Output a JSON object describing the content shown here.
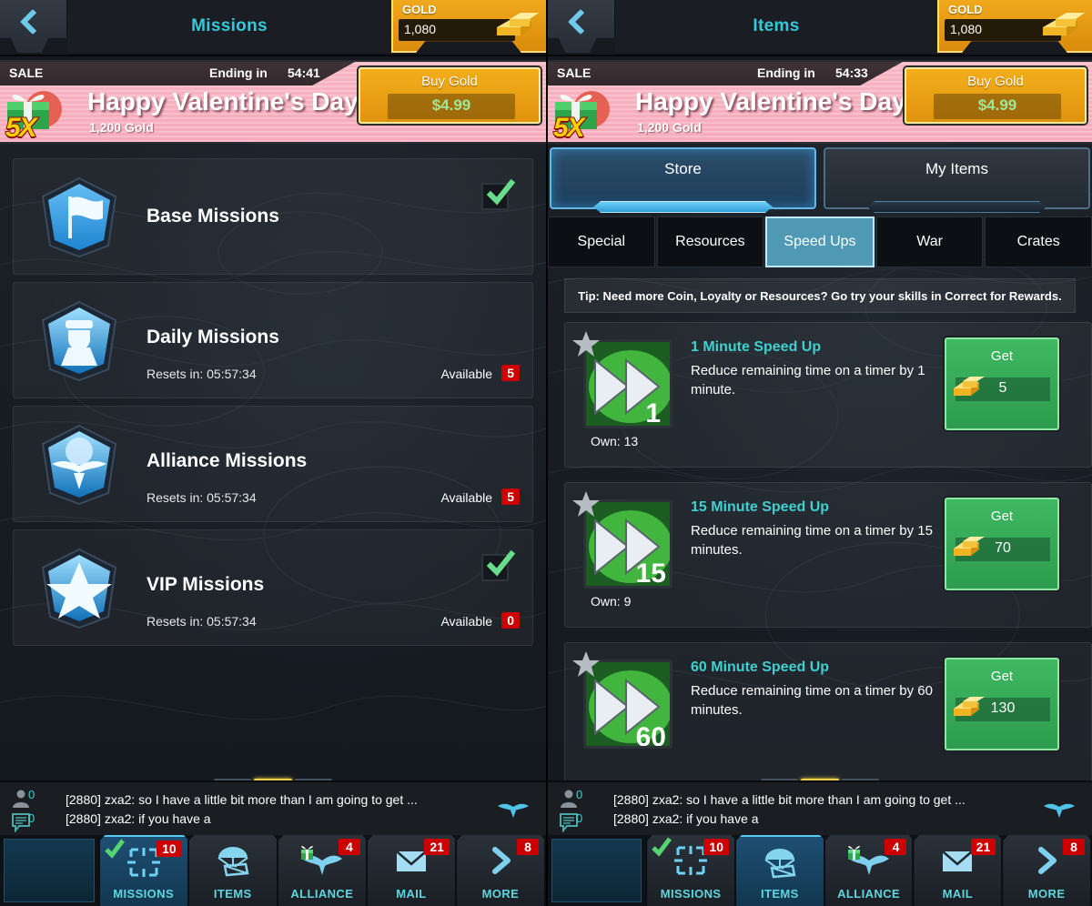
{
  "left": {
    "topbar": {
      "back_icon": "chevron-left-icon",
      "title": "Missions"
    },
    "gold": {
      "label": "GOLD",
      "value": "1,080",
      "icon": "gold-bars-icon"
    },
    "sale": {
      "tag": "SALE",
      "ending_label": "Ending in",
      "ending_time": "54:41",
      "multiplier": "5X",
      "title": "Happy Valentine's Day!",
      "subtitle": "1,200 Gold",
      "buy_label": "Buy Gold",
      "price": "$4.99"
    },
    "missions": [
      {
        "icon": "flag-badge-icon",
        "title": "Base Missions",
        "reset": "",
        "available_label": "",
        "available": "",
        "complete": true
      },
      {
        "icon": "soldier-badge-icon",
        "title": "Daily Missions",
        "reset": "Resets in:  05:57:34",
        "available_label": "Available",
        "available": "5",
        "complete": false
      },
      {
        "icon": "alliance-eagle-badge-icon",
        "title": "Alliance Missions",
        "reset": "Resets in:  05:57:34",
        "available_label": "Available",
        "available": "5",
        "complete": false
      },
      {
        "icon": "star-badge-icon",
        "title": "VIP Missions",
        "reset": "Resets in:  05:57:34",
        "available_label": "Available",
        "available": "0",
        "complete": true
      }
    ]
  },
  "right": {
    "topbar": {
      "back_icon": "chevron-left-icon",
      "title": "Items"
    },
    "gold": {
      "label": "GOLD",
      "value": "1,080",
      "icon": "gold-bars-icon"
    },
    "sale": {
      "tag": "SALE",
      "ending_label": "Ending in",
      "ending_time": "54:33",
      "multiplier": "5X",
      "title": "Happy Valentine's Day!",
      "subtitle": "1,200 Gold",
      "buy_label": "Buy Gold",
      "price": "$4.99"
    },
    "store_tabs": [
      {
        "label": "Store",
        "active": true
      },
      {
        "label": "My Items",
        "active": false
      }
    ],
    "category_tabs": [
      {
        "label": "Special",
        "active": false
      },
      {
        "label": "Resources",
        "active": false
      },
      {
        "label": "Speed Ups",
        "active": true
      },
      {
        "label": "War",
        "active": false
      },
      {
        "label": "Crates",
        "active": false
      }
    ],
    "tip": "Tip: Need more Coin, Loyalty or Resources? Go try your skills in Correct for Rewards.",
    "items": [
      {
        "thumb_icon": "fast-forward-green-icon",
        "thumb_number": "1",
        "star_icon": "star-icon",
        "name": "1 Minute Speed Up",
        "description": "Reduce remaining time on a timer by 1 minute.",
        "own": "Own: 13",
        "get_label": "Get",
        "cost": "5",
        "cost_icon": "gold-bars-icon"
      },
      {
        "thumb_icon": "fast-forward-green-icon",
        "thumb_number": "15",
        "star_icon": "star-icon",
        "name": "15 Minute Speed Up",
        "description": "Reduce remaining time on a timer by 15 minutes.",
        "own": "Own: 9",
        "get_label": "Get",
        "cost": "70",
        "cost_icon": "gold-bars-icon"
      },
      {
        "thumb_icon": "fast-forward-green-icon",
        "thumb_number": "60",
        "star_icon": "star-icon",
        "name": "60 Minute Speed Up",
        "description": "Reduce remaining time on a timer by 60 minutes.",
        "own": "",
        "get_label": "Get",
        "cost": "130",
        "cost_icon": "gold-bars-icon"
      }
    ]
  },
  "chat": {
    "person_icon": "person-icon",
    "person_count": "0",
    "message_icon": "message-lines-icon",
    "message_count": "0",
    "line1": "[2880] zxa2: so I have a little bit more than I am going to get ...",
    "line2": "[2880] zxa2: if you have a",
    "emblem_icon": "alliance-eagle-icon"
  },
  "bottom_nav_left": [
    {
      "name": "hq",
      "icon": "base-hq-icon",
      "label": "",
      "badge": "",
      "check": false,
      "active": false
    },
    {
      "name": "missions",
      "icon": "crosshair-icon",
      "label": "MISSIONS",
      "badge": "10",
      "check": true,
      "active": true
    },
    {
      "name": "items",
      "icon": "parachute-crate-icon",
      "label": "ITEMS",
      "badge": "",
      "check": false,
      "active": false
    },
    {
      "name": "alliance",
      "icon": "alliance-eagle-gift-icon",
      "label": "ALLIANCE",
      "badge": "4",
      "check": false,
      "active": false
    },
    {
      "name": "mail",
      "icon": "envelope-icon",
      "label": "MAIL",
      "badge": "21",
      "check": false,
      "active": false
    },
    {
      "name": "more",
      "icon": "chevron-right-icon",
      "label": "MORE",
      "badge": "8",
      "check": false,
      "active": false
    }
  ],
  "bottom_nav_right": [
    {
      "name": "hq",
      "icon": "base-hq-icon",
      "label": "",
      "badge": "",
      "check": false,
      "active": false
    },
    {
      "name": "missions",
      "icon": "crosshair-icon",
      "label": "MISSIONS",
      "badge": "10",
      "check": true,
      "active": false
    },
    {
      "name": "items",
      "icon": "parachute-crate-icon",
      "label": "ITEMS",
      "badge": "",
      "check": false,
      "active": true
    },
    {
      "name": "alliance",
      "icon": "alliance-eagle-gift-icon",
      "label": "ALLIANCE",
      "badge": "4",
      "check": false,
      "active": false
    },
    {
      "name": "mail",
      "icon": "envelope-icon",
      "label": "MAIL",
      "badge": "21",
      "check": false,
      "active": false
    },
    {
      "name": "more",
      "icon": "chevron-right-icon",
      "label": "MORE",
      "badge": "8",
      "check": false,
      "active": false
    }
  ],
  "page_indicator": {
    "segments": 3,
    "active_index": 1
  },
  "colors": {
    "accent_cyan": "#36c8d8",
    "gold": "#f0a81c",
    "sale_pink": "#f6aabb",
    "green_button": "#3fb862",
    "badge_red": "#cc0000",
    "item_name_teal": "#3fd0cf"
  }
}
